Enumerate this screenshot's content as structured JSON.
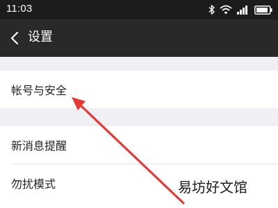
{
  "status_bar": {
    "time": "11:03",
    "icons": [
      "bluetooth-icon",
      "wifi-icon",
      "signal-icon",
      "battery-icon"
    ]
  },
  "app_bar": {
    "back_icon": "chevron-left-icon",
    "title": "设置"
  },
  "settings": {
    "account_security": "帐号与安全",
    "new_message_alert": "新消息提醒",
    "do_not_disturb": "勿扰模式"
  },
  "annotation": {
    "arrow_color": "#e53935"
  },
  "watermark": {
    "text": "易坊好文馆"
  },
  "colors": {
    "status_bar_bg": "#1c1c1c",
    "app_bar_bg": "#292929",
    "page_bg": "#efeff4",
    "row_bg": "#ffffff"
  }
}
